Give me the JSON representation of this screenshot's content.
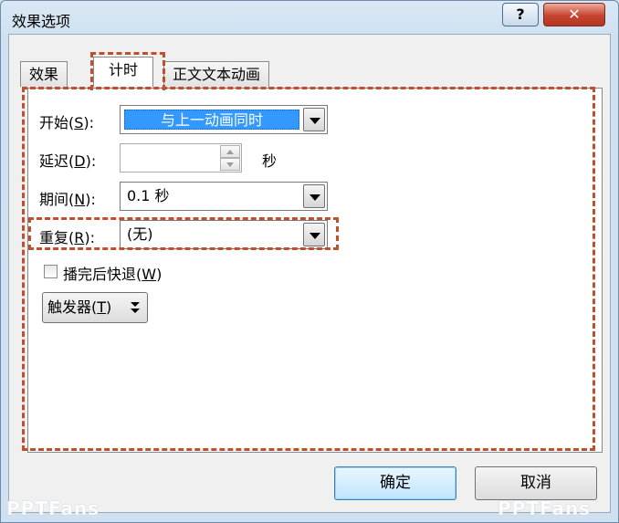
{
  "window": {
    "title": "效果选项",
    "help_label": "?",
    "close_label": "✕"
  },
  "tabs": [
    {
      "label": "效果",
      "active": false
    },
    {
      "label": "计时",
      "active": true
    },
    {
      "label": "正文文本动画",
      "active": false
    }
  ],
  "timing": {
    "start": {
      "label": "开始(",
      "hotkey": "S",
      "suffix": "):",
      "value": "与上一动画同时"
    },
    "delay": {
      "label": "延迟(",
      "hotkey": "D",
      "suffix": "):",
      "value": "",
      "unit": "秒"
    },
    "duration": {
      "label": "期间(",
      "hotkey": "N",
      "suffix": "):",
      "value": "0.1 秒"
    },
    "repeat": {
      "label": "重复(",
      "hotkey": "R",
      "suffix": "):",
      "value": "(无)"
    },
    "rewind": {
      "label": "播完后快退(",
      "hotkey": "W",
      "suffix": ")",
      "checked": false
    },
    "triggers": {
      "label": "触发器(",
      "hotkey": "T",
      "suffix": ")"
    }
  },
  "footer": {
    "ok_label": "确定",
    "cancel_label": "取消"
  },
  "watermark": "PPTFans",
  "colors": {
    "selection": "#3399ff",
    "highlight_dash": "#c0502d",
    "close_red": "#c7442f"
  }
}
